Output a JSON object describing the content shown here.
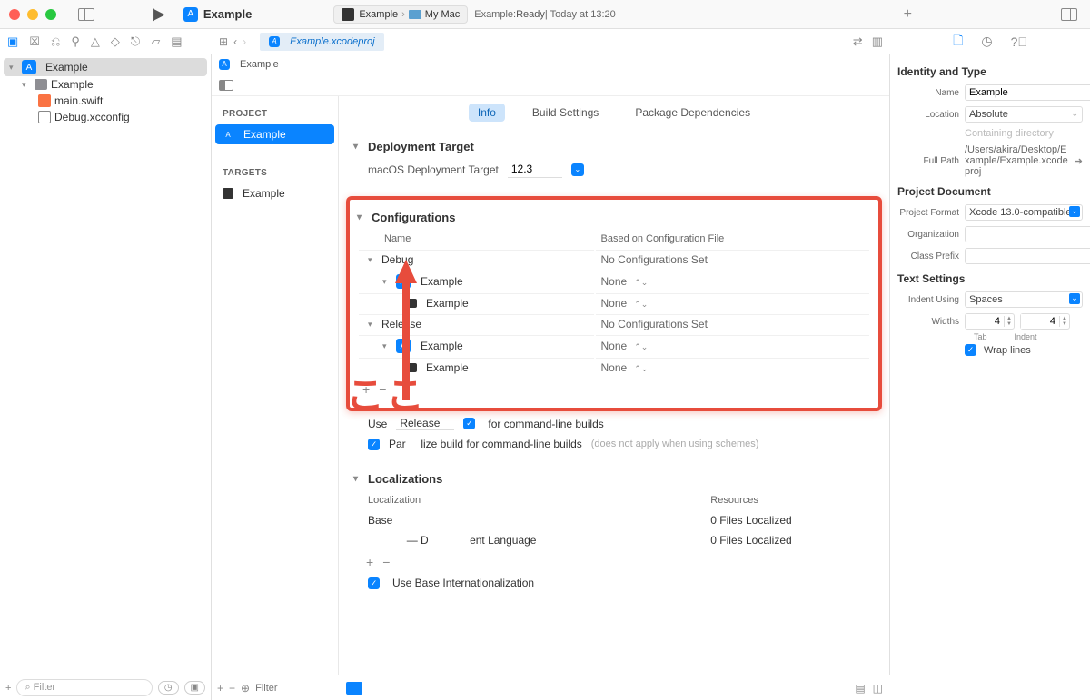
{
  "titlebar": {
    "app_name": "Example",
    "scheme": "Example",
    "destination": "My Mac",
    "status_prefix": "Example: ",
    "status_ready": "Ready",
    "status_time": " | Today at 13:20"
  },
  "toolbar": {
    "tab_file": "Example.xcodeproj"
  },
  "navigator": {
    "root": "Example",
    "folder": "Example",
    "files": [
      "main.swift",
      "Debug.xcconfig"
    ],
    "filter_placeholder": "Filter"
  },
  "crumb": "Example",
  "project_sidebar": {
    "project_label": "PROJECT",
    "project_item": "Example",
    "targets_label": "TARGETS",
    "target_item": "Example",
    "filter_placeholder": "Filter"
  },
  "tabs": {
    "info": "Info",
    "build": "Build Settings",
    "deps": "Package Dependencies"
  },
  "deployment": {
    "title": "Deployment Target",
    "label": "macOS Deployment Target",
    "value": "12.3"
  },
  "configurations": {
    "title": "Configurations",
    "col_name": "Name",
    "col_based": "Based on Configuration File",
    "debug": "Debug",
    "release": "Release",
    "project": "Example",
    "target": "Example",
    "no_config": "No Configurations Set",
    "none": "None"
  },
  "build_opts": {
    "use": "Use",
    "release_val": "Release",
    "for_cli": "for command-line builds",
    "parallelize": "Parallelize build for command-line builds",
    "parallelize_hint": "(does not apply when using schemes)"
  },
  "localizations": {
    "title": "Localizations",
    "col_loc": "Localization",
    "col_res": "Resources",
    "base": "Base",
    "dev_lang_suffix": "ent Language",
    "zero_files": "0 Files Localized",
    "use_base": "Use Base Internationalization"
  },
  "annotation": "ここ",
  "inspector": {
    "identity_title": "Identity and Type",
    "name_label": "Name",
    "name_value": "Example",
    "location_label": "Location",
    "location_value": "Absolute",
    "containing": "Containing directory",
    "fullpath_label": "Full Path",
    "fullpath_value": "/Users/akira/Desktop/Example/Example.xcodeproj",
    "projdoc_title": "Project Document",
    "format_label": "Project Format",
    "format_value": "Xcode 13.0-compatible",
    "org_label": "Organization",
    "prefix_label": "Class Prefix",
    "text_title": "Text Settings",
    "indent_label": "Indent Using",
    "indent_value": "Spaces",
    "widths_label": "Widths",
    "tab_val": "4",
    "indent_val": "4",
    "tab_caption": "Tab",
    "indent_caption": "Indent",
    "wrap": "Wrap lines"
  }
}
